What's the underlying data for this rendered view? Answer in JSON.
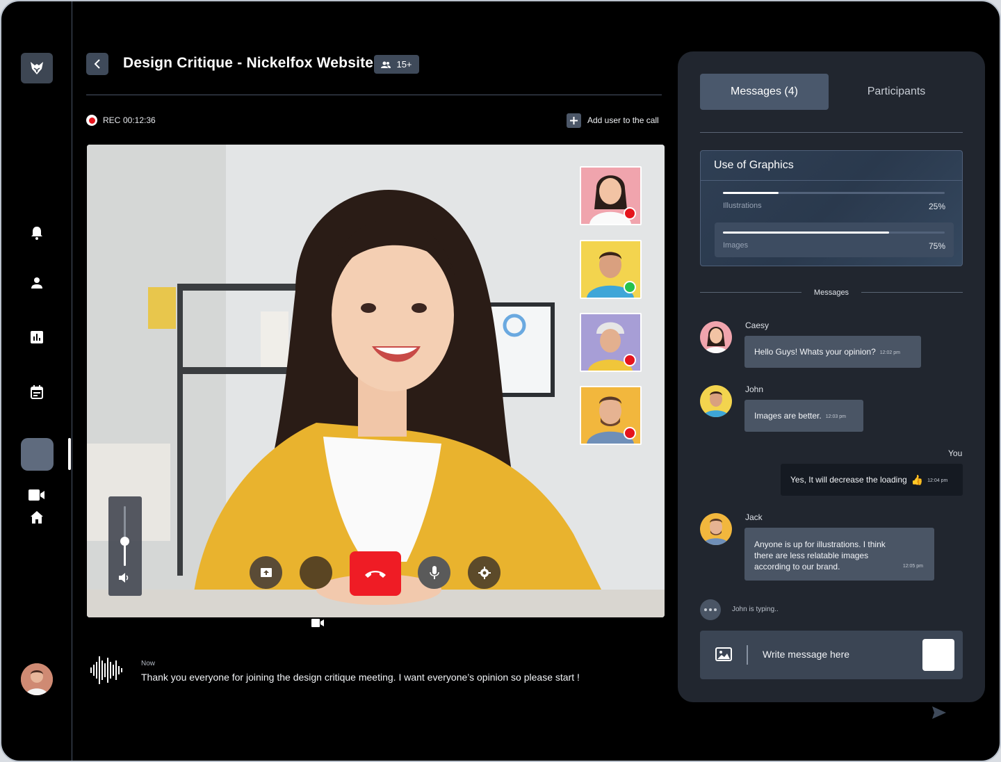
{
  "sidebar": {
    "logo": "fox-logo-icon",
    "nav_items": [
      "bell-icon",
      "user-icon",
      "chart-icon",
      "calendar-icon",
      "video-icon",
      "home-icon"
    ]
  },
  "header": {
    "title": "Design Critique - Nickelfox Website",
    "participants_count": "15+",
    "rec_label": "REC",
    "rec_time": "00:12:36",
    "add_user_label": "Add user to the call"
  },
  "video": {
    "volume_level": 0.42,
    "controls": [
      "share-screen-icon",
      "camera-toggle",
      "end-call-icon",
      "mic-icon",
      "settings-icon"
    ],
    "thumbnails": [
      {
        "status": "muted",
        "status_color": "#e5141c",
        "bg": "#f0a4ad"
      },
      {
        "status": "speaking",
        "status_color": "#27c24c",
        "bg": "#f3d44e"
      },
      {
        "status": "muted",
        "status_color": "#e5141c",
        "bg": "#a79ed6"
      },
      {
        "status": "muted",
        "status_color": "#e5141c",
        "bg": "#f2b73d"
      }
    ]
  },
  "caption": {
    "time": "Now",
    "text": "Thank you everyone for joining the design critique meeting. I want everyone’s opinion so please start !"
  },
  "panel": {
    "tabs": {
      "messages": "Messages (4)",
      "participants": "Participants"
    },
    "poll": {
      "title": "Use of Graphics",
      "options": [
        {
          "label": "Illustrations",
          "percent": "25%",
          "value": 0.25,
          "selected": false
        },
        {
          "label": "Images",
          "percent": "75%",
          "value": 0.75,
          "selected": true
        }
      ]
    },
    "messages_label": "Messages",
    "messages": [
      {
        "sender": "Caesy",
        "text": "Hello Guys! Whats your opinion?",
        "time": "12:02 pm"
      },
      {
        "sender": "John",
        "text": "Images are better.",
        "time": "12:03 pm"
      },
      {
        "sender": "You",
        "text": "Yes, It will decrease the loading",
        "emoji": "👍",
        "time": "12:04 pm"
      },
      {
        "sender": "Jack",
        "text": "Anyone is up for illustrations. I think there are less relatable images according to our brand.",
        "time": "12:05 pm"
      }
    ],
    "typing": "John is typing..",
    "composer_placeholder": "Write message here"
  }
}
